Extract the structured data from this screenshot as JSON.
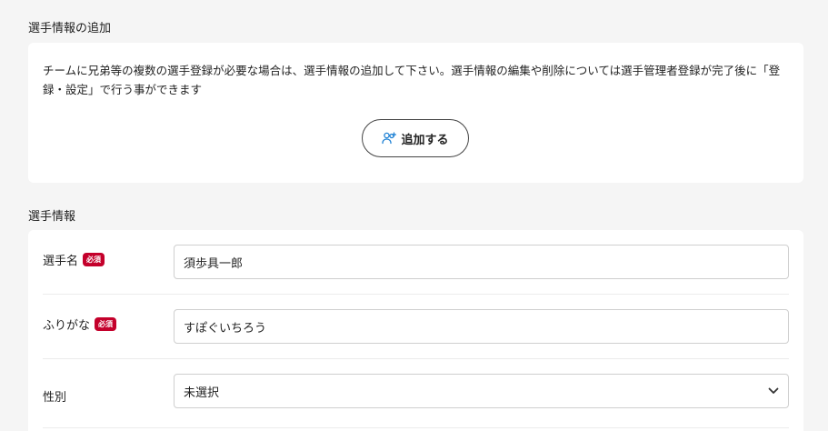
{
  "add_section": {
    "title": "選手情報の追加",
    "notice": "チームに兄弟等の複数の選手登録が必要な場合は、選手情報の追加して下さい。選手情報の編集や削除については選手管理者登録が完了後に「登録・設定」で行う事ができます",
    "add_button_label": "追加する",
    "add_button_icon": "user-plus-icon"
  },
  "player_section": {
    "title": "選手情報",
    "required_badge": "必須",
    "fields": {
      "name": {
        "label": "選手名",
        "value": "須歩具一郎"
      },
      "kana": {
        "label": "ふりがな",
        "value": "すぽぐいちろう"
      },
      "gender": {
        "label": "性別",
        "selected": "未選択"
      }
    }
  },
  "colors": {
    "badge": "#c4002b",
    "icon_accent": "#1a7fd4",
    "page_bg": "#f5f5f5"
  }
}
